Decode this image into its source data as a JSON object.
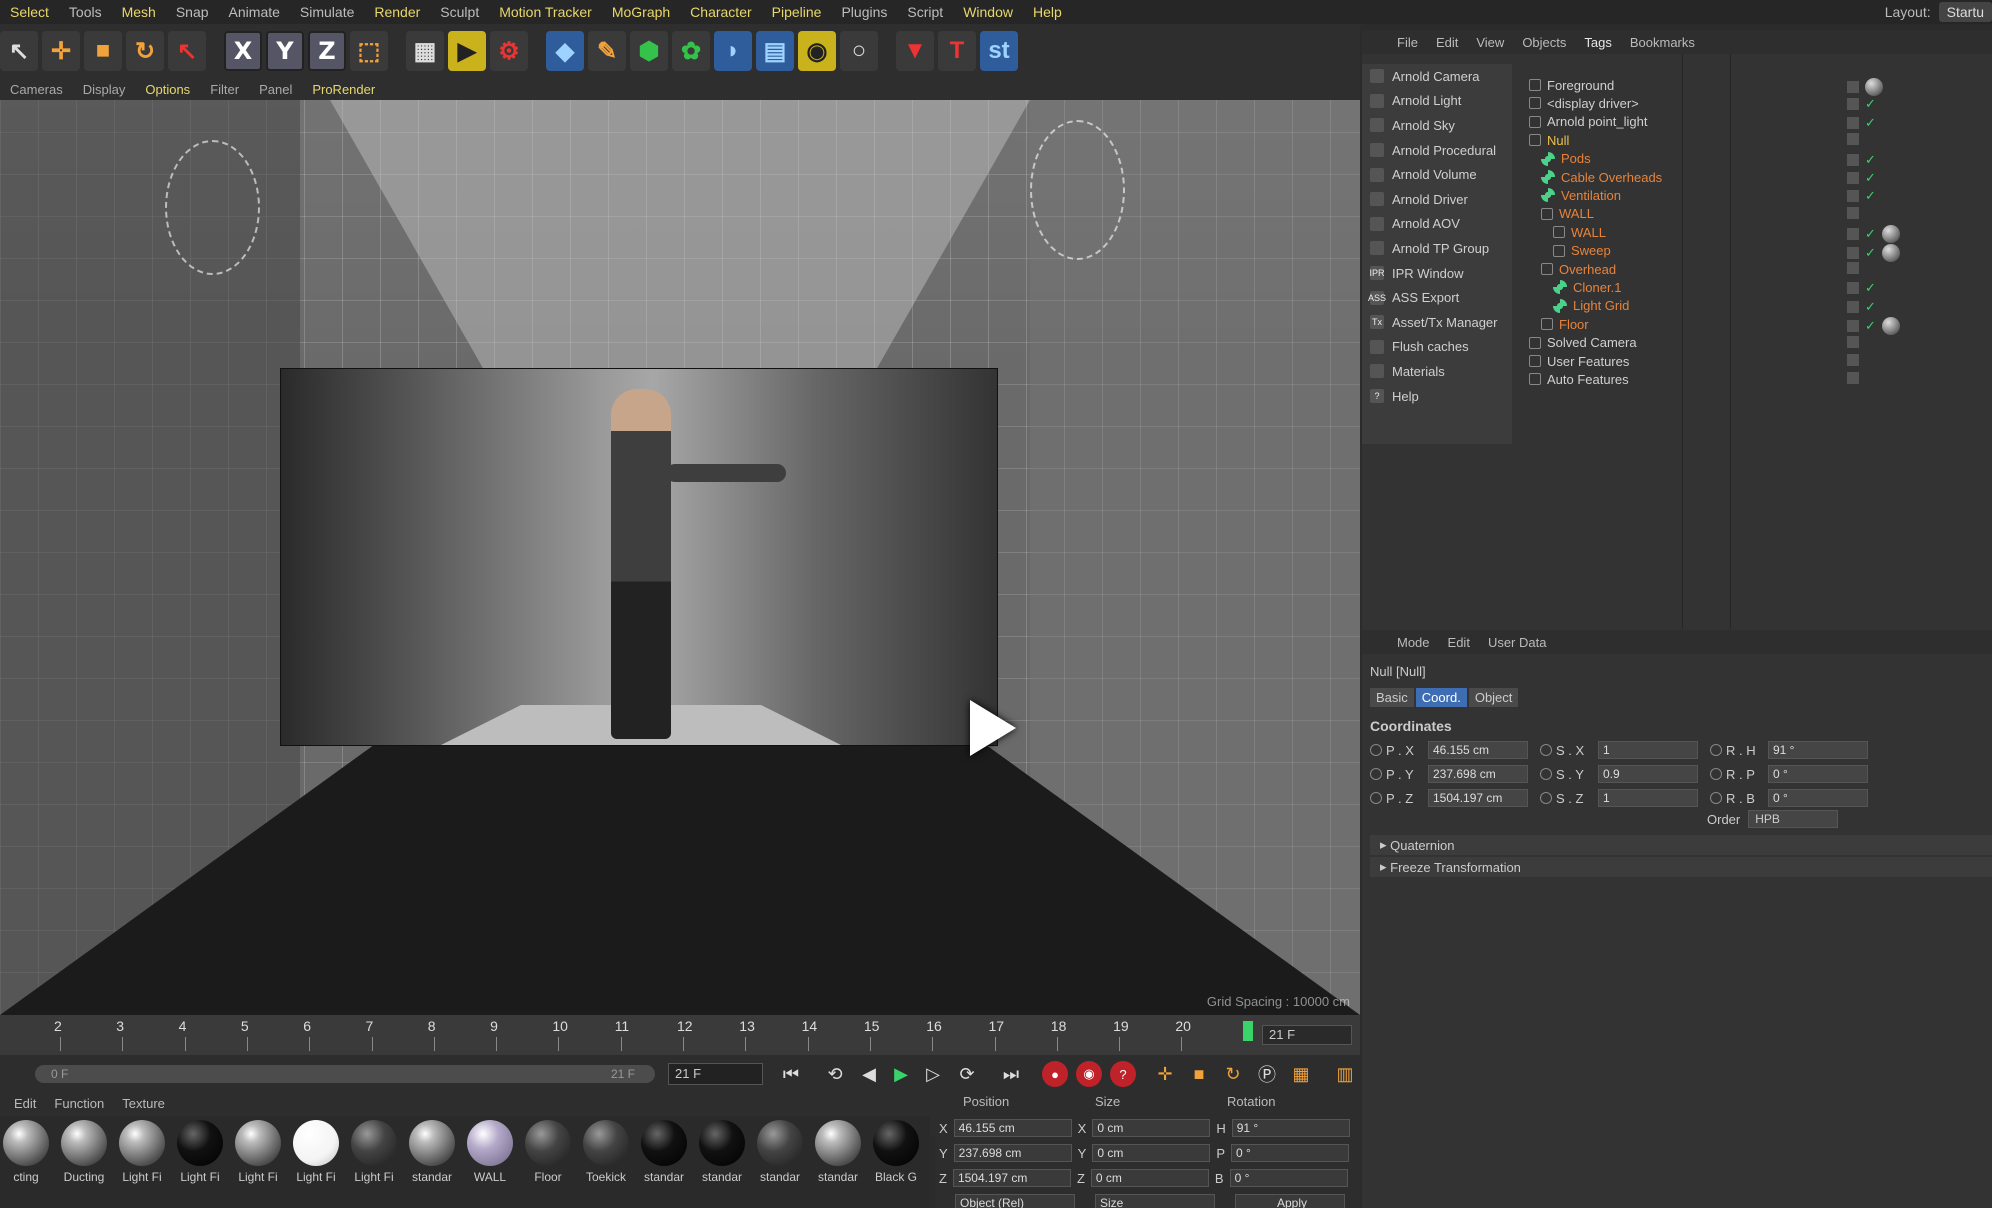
{
  "menubar": {
    "items": [
      {
        "label": "Select",
        "hl": true
      },
      {
        "label": "Tools",
        "hl": false
      },
      {
        "label": "Mesh",
        "hl": true
      },
      {
        "label": "Snap",
        "hl": false
      },
      {
        "label": "Animate",
        "hl": false
      },
      {
        "label": "Simulate",
        "hl": false
      },
      {
        "label": "Render",
        "hl": true
      },
      {
        "label": "Sculpt",
        "hl": false
      },
      {
        "label": "Motion Tracker",
        "hl": true
      },
      {
        "label": "MoGraph",
        "hl": true
      },
      {
        "label": "Character",
        "hl": true
      },
      {
        "label": "Pipeline",
        "hl": true
      },
      {
        "label": "Plugins",
        "hl": false
      },
      {
        "label": "Script",
        "hl": false
      },
      {
        "label": "Window",
        "hl": true
      },
      {
        "label": "Help",
        "hl": true
      }
    ],
    "layout_label": "Layout:",
    "layout_value": "Startu"
  },
  "toolbar": {
    "axis_x": "X",
    "axis_y": "Y",
    "axis_z": "Z",
    "text_tool": "T",
    "st_tool": "st"
  },
  "viewport_menu": {
    "items": [
      {
        "label": "Cameras",
        "hl": false
      },
      {
        "label": "Display",
        "hl": false
      },
      {
        "label": "Options",
        "hl": true
      },
      {
        "label": "Filter",
        "hl": false
      },
      {
        "label": "Panel",
        "hl": false
      },
      {
        "label": "ProRender",
        "hl": true
      }
    ]
  },
  "viewport": {
    "grid_spacing": "Grid Spacing : 10000 cm"
  },
  "timeline": {
    "ticks": [
      "2",
      "3",
      "4",
      "5",
      "6",
      "7",
      "8",
      "9",
      "10",
      "11",
      "12",
      "13",
      "14",
      "15",
      "16",
      "17",
      "18",
      "19",
      "20"
    ],
    "current": "21 F"
  },
  "transport": {
    "range_start": "0 F",
    "range_end": "21 F",
    "current_frame": "21 F"
  },
  "material_manager": {
    "menu": [
      "Edit",
      "Function",
      "Texture"
    ],
    "materials": [
      {
        "label": "cting",
        "kind": ""
      },
      {
        "label": "Ducting",
        "kind": ""
      },
      {
        "label": "Light Fi",
        "kind": ""
      },
      {
        "label": "Light Fi",
        "kind": "black"
      },
      {
        "label": "Light Fi",
        "kind": ""
      },
      {
        "label": "Light Fi",
        "kind": "white"
      },
      {
        "label": "Light Fi",
        "kind": "dark"
      },
      {
        "label": "standar",
        "kind": ""
      },
      {
        "label": "WALL",
        "kind": "lilac"
      },
      {
        "label": "Floor",
        "kind": "dark"
      },
      {
        "label": "Toekick",
        "kind": "dark"
      },
      {
        "label": "standar",
        "kind": "black"
      },
      {
        "label": "standar",
        "kind": "black"
      },
      {
        "label": "standar",
        "kind": "dark"
      },
      {
        "label": "standar",
        "kind": ""
      },
      {
        "label": "Black G",
        "kind": "black"
      }
    ]
  },
  "coord_manager": {
    "headers": [
      "Position",
      "Size",
      "Rotation"
    ],
    "rows": [
      {
        "pl": "X",
        "pv": "46.155 cm",
        "sl": "X",
        "sv": "0 cm",
        "rl": "H",
        "rv": "91 °"
      },
      {
        "pl": "Y",
        "pv": "237.698 cm",
        "sl": "Y",
        "sv": "0 cm",
        "rl": "P",
        "rv": "0 °"
      },
      {
        "pl": "Z",
        "pv": "1504.197 cm",
        "sl": "Z",
        "sv": "0 cm",
        "rl": "B",
        "rv": "0 °"
      }
    ],
    "mode_select": "Object (Rel)",
    "size_select": "Size",
    "apply": "Apply"
  },
  "object_manager": {
    "menu": [
      {
        "label": "File",
        "hl": false
      },
      {
        "label": "Edit",
        "hl": false
      },
      {
        "label": "View",
        "hl": false
      },
      {
        "label": "Objects",
        "hl": false
      },
      {
        "label": "Tags",
        "hl": true
      },
      {
        "label": "Bookmarks",
        "hl": false
      }
    ],
    "arnold_menu": [
      {
        "label": "Arnold Camera",
        "icon": "camera-icon",
        "glyph": ""
      },
      {
        "label": "Arnold Light",
        "icon": "light-icon",
        "glyph": ""
      },
      {
        "label": "Arnold Sky",
        "icon": "sky-icon",
        "glyph": ""
      },
      {
        "label": "Arnold Procedural",
        "icon": "procedural-icon",
        "glyph": ""
      },
      {
        "label": "Arnold Volume",
        "icon": "volume-icon",
        "glyph": ""
      },
      {
        "label": "Arnold Driver",
        "icon": "driver-icon",
        "glyph": ""
      },
      {
        "label": "Arnold AOV",
        "icon": "aov-icon",
        "glyph": ""
      },
      {
        "label": "Arnold TP Group",
        "icon": "tp-group-icon",
        "glyph": ""
      },
      {
        "label": "IPR Window",
        "icon": "ipr-icon",
        "glyph": "IPR"
      },
      {
        "label": "ASS Export",
        "icon": "ass-export-icon",
        "glyph": "ASS"
      },
      {
        "label": "Asset/Tx Manager",
        "icon": "tx-manager-icon",
        "glyph": "Tx"
      },
      {
        "label": "Flush caches",
        "icon": "trash-icon",
        "glyph": ""
      },
      {
        "label": "Materials",
        "icon": "material-icon",
        "glyph": ""
      },
      {
        "label": "Help",
        "icon": "help-icon",
        "glyph": "?"
      }
    ],
    "tree": [
      {
        "label": "Foreground",
        "color": "white",
        "indent": 0,
        "check": false,
        "gen": false,
        "tag": true
      },
      {
        "label": "<display driver>",
        "color": "white",
        "indent": 0,
        "check": true,
        "gen": false,
        "tag": false
      },
      {
        "label": "Arnold point_light",
        "color": "white",
        "indent": 0,
        "check": true,
        "gen": false,
        "tag": false
      },
      {
        "label": "Null",
        "color": "yellow",
        "indent": 0,
        "check": false,
        "gen": false,
        "tag": false
      },
      {
        "label": "Pods",
        "color": "orange",
        "indent": 1,
        "check": true,
        "gen": true,
        "tag": false
      },
      {
        "label": "Cable Overheads",
        "color": "orange",
        "indent": 1,
        "check": true,
        "gen": true,
        "tag": false
      },
      {
        "label": "Ventilation",
        "color": "orange",
        "indent": 1,
        "check": true,
        "gen": true,
        "tag": false
      },
      {
        "label": "WALL",
        "color": "orange",
        "indent": 1,
        "check": false,
        "gen": false,
        "tag": false
      },
      {
        "label": "WALL",
        "color": "orange",
        "indent": 2,
        "check": true,
        "gen": false,
        "tag": true
      },
      {
        "label": "Sweep",
        "color": "orange",
        "indent": 2,
        "check": true,
        "gen": false,
        "tag": true
      },
      {
        "label": "Overhead",
        "color": "orange",
        "indent": 1,
        "check": false,
        "gen": false,
        "tag": false
      },
      {
        "label": "Cloner.1",
        "color": "orange",
        "indent": 2,
        "check": true,
        "gen": true,
        "tag": false
      },
      {
        "label": "Light Grid",
        "color": "orange",
        "indent": 2,
        "check": true,
        "gen": true,
        "tag": false
      },
      {
        "label": "Floor",
        "color": "orange",
        "indent": 1,
        "check": true,
        "gen": false,
        "tag": true
      },
      {
        "label": "Solved Camera",
        "color": "white",
        "indent": 0,
        "check": false,
        "gen": false,
        "tag": false
      },
      {
        "label": "User Features",
        "color": "white",
        "indent": 0,
        "check": false,
        "gen": false,
        "tag": false
      },
      {
        "label": "Auto Features",
        "color": "white",
        "indent": 0,
        "check": false,
        "gen": false,
        "tag": false
      }
    ]
  },
  "attribute_manager": {
    "menu": [
      "Mode",
      "Edit",
      "User Data"
    ],
    "title": "Null [Null]",
    "tabs": [
      {
        "label": "Basic",
        "active": false
      },
      {
        "label": "Coord.",
        "active": true
      },
      {
        "label": "Object",
        "active": false
      }
    ],
    "section_title": "Coordinates",
    "rows": [
      {
        "a": "P . X",
        "av": "46.155 cm",
        "b": "S . X",
        "bv": "1",
        "c": "R . H",
        "cv": "91 °"
      },
      {
        "a": "P . Y",
        "av": "237.698 cm",
        "b": "S . Y",
        "bv": "0.9",
        "c": "R . P",
        "cv": "0 °"
      },
      {
        "a": "P . Z",
        "av": "1504.197 cm",
        "b": "S . Z",
        "bv": "1",
        "c": "R . B",
        "cv": "0 °"
      }
    ],
    "order_label": "Order",
    "order_value": "HPB",
    "collapsibles": [
      "Quaternion",
      "Freeze Transformation"
    ]
  }
}
